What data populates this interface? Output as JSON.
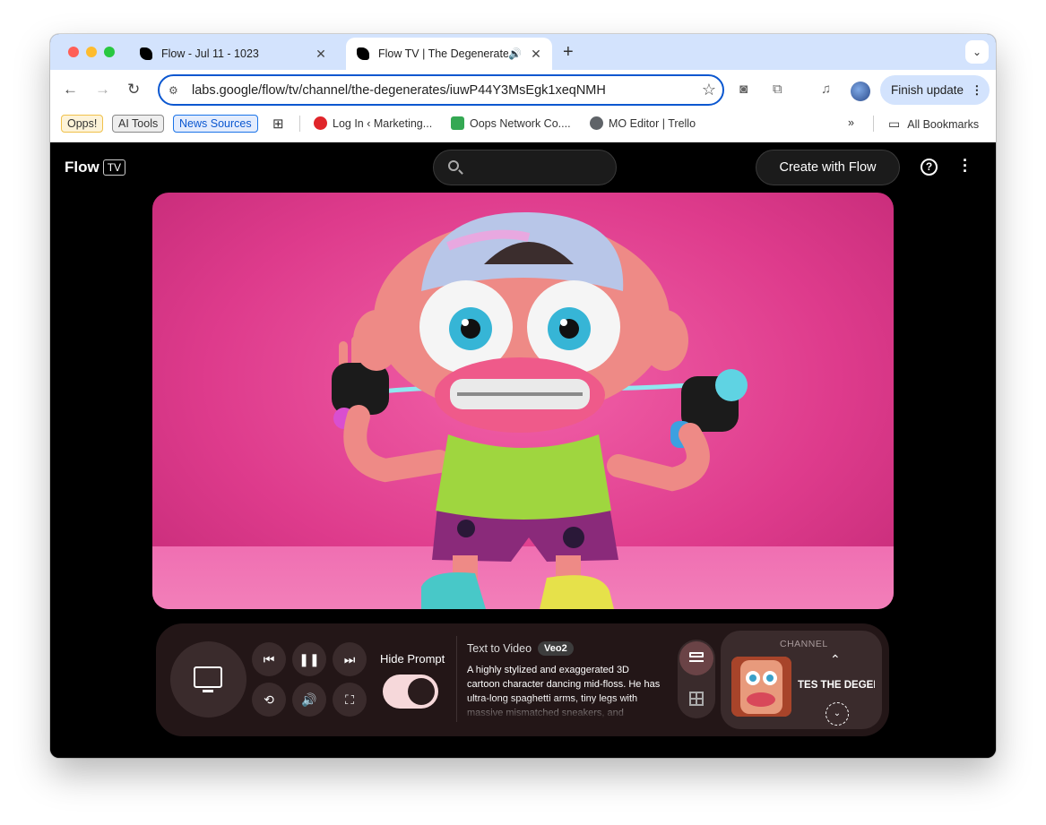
{
  "browser": {
    "tabs": [
      {
        "title": "Flow - Jul 11 - 1023"
      },
      {
        "title": "Flow TV | The Degenerates"
      }
    ],
    "url": "labs.google/flow/tv/channel/the-degenerates/iuwP44Y3MsEgk1xeqNMH",
    "update_label": "Finish update",
    "bookmarks": [
      {
        "label": "Opps!"
      },
      {
        "label": "AI Tools"
      },
      {
        "label": "News Sources"
      },
      {
        "label": "Log In ‹ Marketing..."
      },
      {
        "label": "Oops Network Co...."
      },
      {
        "label": "MO Editor | Trello"
      }
    ],
    "all_bookmarks": "All Bookmarks"
  },
  "app": {
    "logo": "Flow",
    "logo_badge": "TV",
    "search_placeholder": "",
    "create_label": "Create with Flow"
  },
  "player": {
    "hide_prompt_label": "Hide Prompt",
    "prompt_type": "Text to Video",
    "model_badge": "Veo2",
    "prompt_text": "A highly stylized and exaggerated 3D cartoon character dancing mid-floss. He has ultra-long spaghetti arms, tiny legs with massive mismatched sneakers, and",
    "channel_label": "CHANNEL",
    "channel_name": "TES   THE DEGENERATES",
    "hide_prompt_on": true
  },
  "colors": {
    "accent_blue": "#0b57d0",
    "video_pink": "#de3b8c",
    "toggle_on": "#f6d8da"
  }
}
